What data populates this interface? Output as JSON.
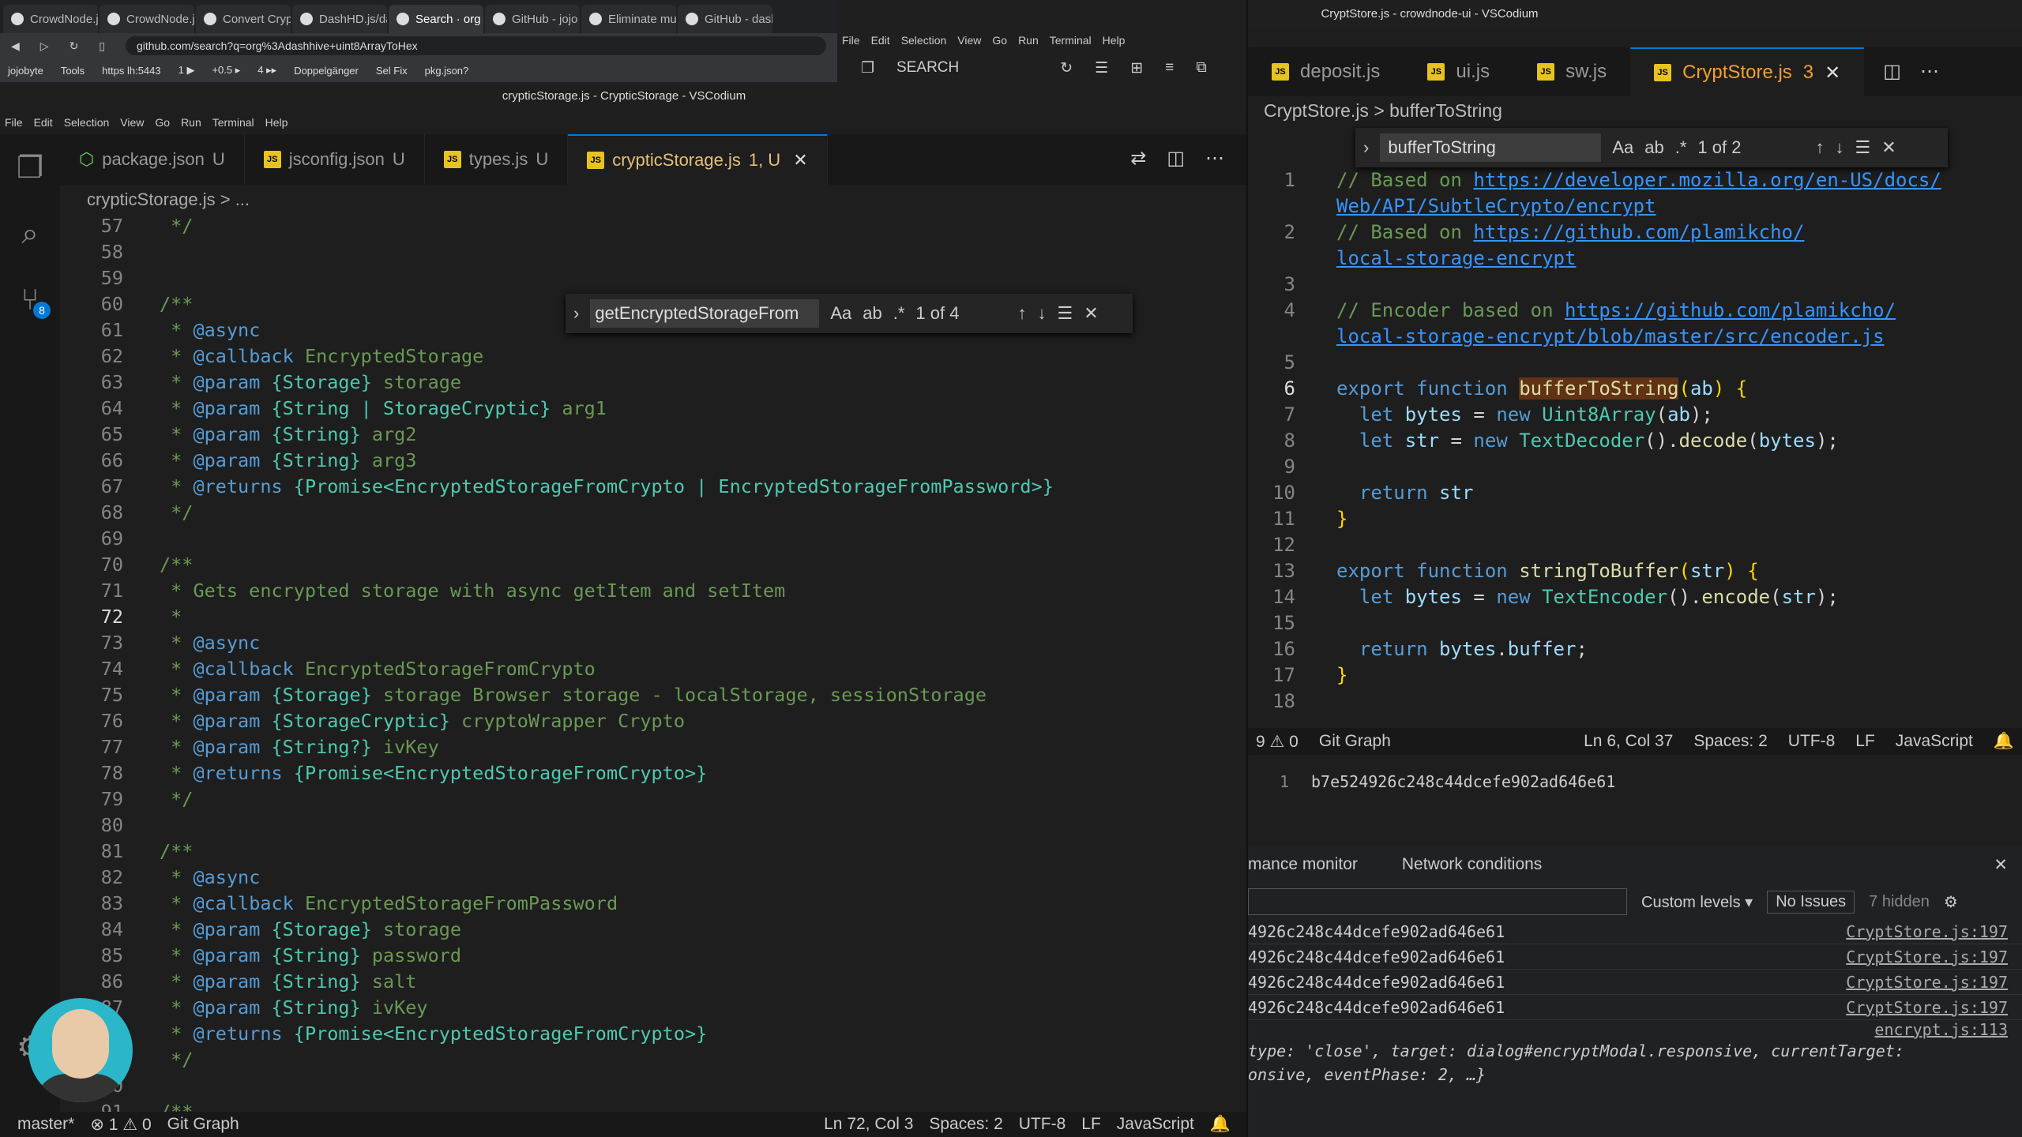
{
  "browser": {
    "tabs": [
      "CrowdNode.j",
      "CrowdNode.j",
      "Convert Crypt",
      "DashHD.js/da",
      "Search · org",
      "GitHub - jojo",
      "Eliminate mu",
      "GitHub - dash",
      "GitHub -"
    ],
    "url": "github.com/search?q=org%3Adashhive+uint8ArrayToHex",
    "bookmarks": [
      "jojobyte",
      "Tools",
      "https lh:5443",
      "1 ▶",
      "+0.5 ▸",
      "4 ▸▸",
      "Doppelgänger",
      "Sel Fix",
      "pkg.json?"
    ]
  },
  "left": {
    "title": "crypticStorage.js - CrypticStorage - VSCodium",
    "menu": [
      "File",
      "Edit",
      "Selection",
      "View",
      "Go",
      "Run",
      "Terminal",
      "Help"
    ],
    "tabs": [
      {
        "label": "package.json",
        "badge": "U"
      },
      {
        "label": "jsconfig.json",
        "badge": "U"
      },
      {
        "label": "types.js",
        "badge": "U"
      },
      {
        "label": "crypticStorage.js",
        "badge": "1, U"
      }
    ],
    "breadcrumb": "crypticStorage.js > ...",
    "scm_badge": "8",
    "find": {
      "value": "getEncryptedStorageFrom",
      "result": "1 of 4"
    },
    "lines": [
      [
        "57",
        " */"
      ],
      [
        "58",
        ""
      ],
      [
        "59",
        ""
      ],
      [
        "60",
        "/**"
      ],
      [
        "61",
        " * @async"
      ],
      [
        "62",
        " * @callback EncryptedStorage"
      ],
      [
        "63",
        " * @param {Storage} storage"
      ],
      [
        "64",
        " * @param {String | StorageCryptic} arg1"
      ],
      [
        "65",
        " * @param {String} arg2"
      ],
      [
        "66",
        " * @param {String} arg3"
      ],
      [
        "67",
        " * @returns {Promise<EncryptedStorageFromCrypto | EncryptedStorageFromPassword>}"
      ],
      [
        "68",
        " */"
      ],
      [
        "69",
        ""
      ],
      [
        "70",
        "/**"
      ],
      [
        "71",
        " * Gets encrypted storage with async getItem and setItem"
      ],
      [
        "72",
        " *"
      ],
      [
        "73",
        " * @async"
      ],
      [
        "74",
        " * @callback EncryptedStorageFromCrypto"
      ],
      [
        "75",
        " * @param {Storage} storage Browser storage - localStorage, sessionStorage"
      ],
      [
        "76",
        " * @param {StorageCryptic} cryptoWrapper Crypto"
      ],
      [
        "77",
        " * @param {String?} ivKey"
      ],
      [
        "78",
        " * @returns {Promise<EncryptedStorageFromCrypto>}"
      ],
      [
        "79",
        " */"
      ],
      [
        "80",
        ""
      ],
      [
        "81",
        "/**"
      ],
      [
        "82",
        " * @async"
      ],
      [
        "83",
        " * @callback EncryptedStorageFromPassword"
      ],
      [
        "84",
        " * @param {Storage} storage"
      ],
      [
        "85",
        " * @param {String} password"
      ],
      [
        "86",
        " * @param {String} salt"
      ],
      [
        "87",
        " * @param {String} ivKey"
      ],
      [
        "",
        ""
      ],
      [
        "88",
        " * @returns {Promise<EncryptedStorageFromCrypto>}"
      ],
      [
        "89",
        " */"
      ],
      [
        "90",
        ""
      ],
      [
        "91",
        "/**"
      ]
    ],
    "status": {
      "branch": "master*",
      "problems": "⊗ 1 ⚠ 0",
      "git": "Git Graph",
      "pos": "Ln 72, Col 3",
      "spaces": "Spaces: 2",
      "enc": "UTF-8",
      "eol": "LF",
      "lang": "JavaScript"
    }
  },
  "right": {
    "title": "CryptStore.js - crowdnode-ui - VSCodium",
    "menu": [
      "File",
      "Edit",
      "Selection",
      "View",
      "Go",
      "Run",
      "Terminal",
      "Help"
    ],
    "search_label": "SEARCH",
    "tabs": [
      {
        "label": "deposit.js",
        "badge": ""
      },
      {
        "label": "ui.js",
        "badge": ""
      },
      {
        "label": "sw.js",
        "badge": ""
      },
      {
        "label": "CryptStore.js",
        "badge": "3"
      }
    ],
    "breadcrumb": "CryptStore.js > bufferToString",
    "find": {
      "value": "bufferToString",
      "result": "1 of 2"
    },
    "status": {
      "problems": "9 ⚠ 0",
      "git": "Git Graph",
      "pos": "Ln 6, Col 37",
      "spaces": "Spaces: 2",
      "enc": "UTF-8",
      "eol": "LF",
      "lang": "JavaScript"
    },
    "terminal_line": {
      "num": "1",
      "text": "b7e524926c248c44dcefe902ad646e61"
    },
    "devtools": {
      "tabs": [
        "mance monitor",
        "Network conditions"
      ],
      "levels": "Custom levels ▾",
      "issues": "No Issues",
      "hidden": "7 hidden",
      "rows": [
        {
          "msg": "4926c248c44dcefe902ad646e61",
          "src": "CryptStore.js:197"
        },
        {
          "msg": "4926c248c44dcefe902ad646e61",
          "src": "CryptStore.js:197"
        },
        {
          "msg": "4926c248c44dcefe902ad646e61",
          "src": "CryptStore.js:197"
        },
        {
          "msg": "4926c248c44dcefe902ad646e61",
          "src": "CryptStore.js:197"
        }
      ],
      "obj_src": "encrypt.js:113",
      "obj_line1": "type: 'close', target: dialog#encryptModal.responsive, currentTarget:",
      "obj_line2": "onsive, eventPhase: 2, …}"
    }
  }
}
